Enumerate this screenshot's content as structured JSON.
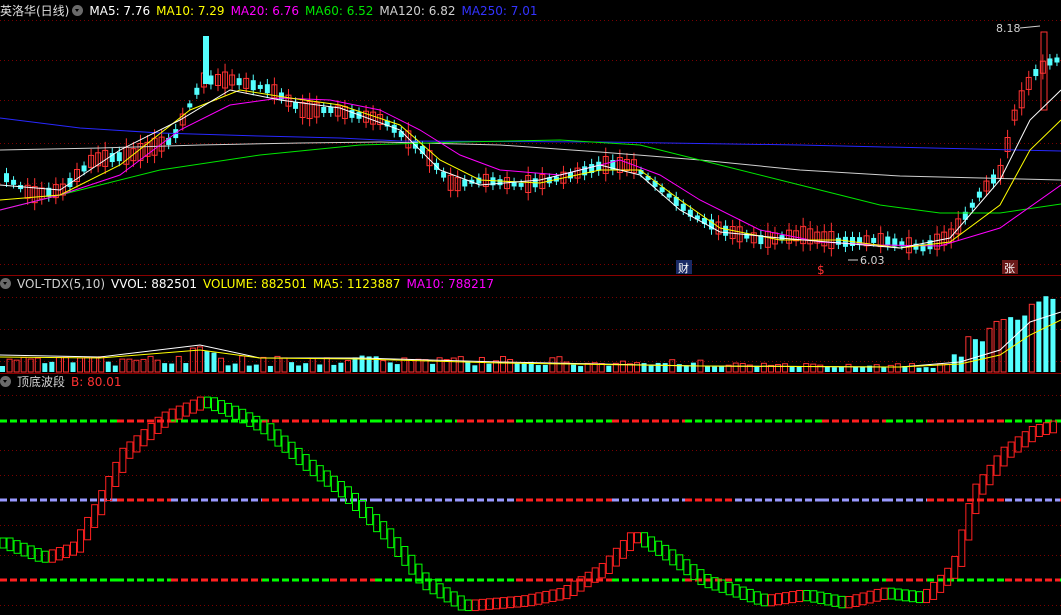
{
  "colors": {
    "up": "#ff3232",
    "down": "#54ffff",
    "ma5": "#ffffff",
    "ma10": "#ffff00",
    "ma20": "#ff00ff",
    "ma60": "#00e600",
    "ma120": "#d0d0d0",
    "ma250": "#2828ff",
    "bg": "#000000",
    "grid": "#7a0000"
  },
  "main": {
    "title": "英洛华(日线)",
    "ma5_label": "MA5: 7.76",
    "ma10_label": "MA10: 7.29",
    "ma20_label": "MA20: 6.76",
    "ma60_label": "MA60: 6.52",
    "ma120_label": "MA120: 6.82",
    "ma250_label": "MA250: 7.01",
    "high_marker": "8.18",
    "low_marker": "6.03",
    "event_markers": [
      "财",
      "$",
      "张"
    ]
  },
  "volume": {
    "title": "VOL-TDX(5,10)",
    "vvol_label": "VVOL: 882501",
    "volume_label": "VOLUME: 882501",
    "ma5_label": "MA5: 1123887",
    "ma10_label": "MA10: 788217"
  },
  "indicator": {
    "title": "顶底波段",
    "b_label": "B: 80.01"
  }
}
